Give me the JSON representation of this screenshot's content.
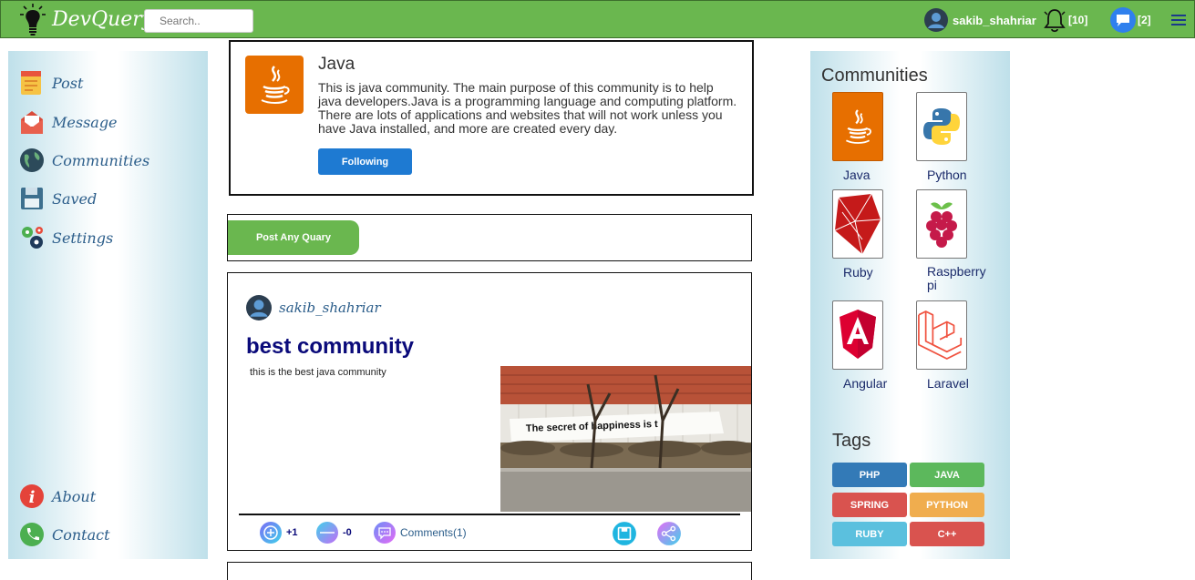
{
  "app": {
    "name": "DevQuery"
  },
  "search": {
    "placeholder": "Search.."
  },
  "topbar": {
    "username": "sakib_shahriar",
    "notifications": "[10]",
    "messages": "[2]"
  },
  "sidebar": {
    "items": [
      {
        "label": "Post",
        "icon": "post-icon"
      },
      {
        "label": "Message",
        "icon": "mail-icon"
      },
      {
        "label": "Communities",
        "icon": "globe-icon"
      },
      {
        "label": "Saved",
        "icon": "floppy-icon"
      },
      {
        "label": "Settings",
        "icon": "gears-icon"
      },
      {
        "label": "About",
        "icon": "info-icon"
      },
      {
        "label": "Contact",
        "icon": "phone-icon"
      }
    ]
  },
  "community": {
    "title": "Java",
    "description": "This is java community. The main purpose of this community is to help java developers.Java is a programming language and computing platform. There are lots of applications and websites that will not work unless you have Java installed, and more are created every day.",
    "follow_label": "Following"
  },
  "post_any": {
    "label": "Post Any Quary"
  },
  "post": {
    "username": "sakib_shahriar",
    "title": "best community",
    "body": "this is the best java community",
    "image_text": "The secret of happiness is t",
    "upvotes": "+1",
    "downvotes": "-0",
    "comments": "Comments(1)"
  },
  "right": {
    "communities_title": "Communities",
    "communities": [
      {
        "label": "Java",
        "color": "#e76f00"
      },
      {
        "label": "Python",
        "color": "#3776ab"
      },
      {
        "label": "Ruby",
        "color": "#cc0000"
      },
      {
        "label": "Raspberry pi",
        "color": "#c51a4a"
      },
      {
        "label": "Angular",
        "color": "#dd0031"
      },
      {
        "label": "Laravel",
        "color": "#ff2d20"
      }
    ],
    "tags_title": "Tags",
    "tags": [
      {
        "label": "PHP",
        "color": "#337ab7"
      },
      {
        "label": "JAVA",
        "color": "#5cb85c"
      },
      {
        "label": "SPRING",
        "color": "#d9534f"
      },
      {
        "label": "PYTHON",
        "color": "#f0ad4e"
      },
      {
        "label": "RUBY",
        "color": "#5bc0de"
      },
      {
        "label": "C++",
        "color": "#d9534f"
      }
    ]
  }
}
